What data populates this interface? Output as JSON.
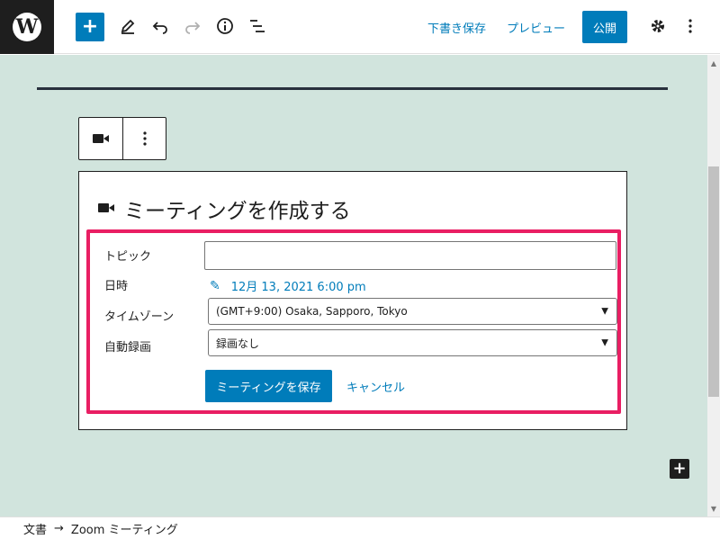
{
  "toolbar": {
    "logo_letter": "W",
    "add_label": "+",
    "edit_icon": "pencil-icon",
    "undo_icon": "undo-icon",
    "redo_icon": "redo-icon",
    "info_icon": "info-icon",
    "outline_icon": "list-view-icon",
    "save_draft_label": "下書き保存",
    "preview_label": "プレビュー",
    "publish_label": "公開",
    "settings_icon": "gear-icon",
    "more_icon": "more-vertical-icon",
    "colors": {
      "accent": "#007cba",
      "dark": "#1e1e1e"
    }
  },
  "canvas": {
    "background": "#d1e4dd"
  },
  "block_toolbar": {
    "block_icon": "video-camera-icon",
    "more_icon": "more-vertical-icon"
  },
  "meeting_block": {
    "title": "ミーティングを作成する",
    "title_icon": "video-camera-icon",
    "highlight_color": "#e91e63",
    "topic": {
      "label": "トピック",
      "value": ""
    },
    "datetime": {
      "label": "日時",
      "value": "12月 13, 2021 6:00 pm"
    },
    "timezone": {
      "label": "タイムゾーン",
      "value": "(GMT+9:00) Osaka, Sapporo, Tokyo"
    },
    "recording": {
      "label": "自動録画",
      "value": "録画なし"
    },
    "save_label": "ミーティングを保存",
    "cancel_label": "キャンセル"
  },
  "inserter": {
    "label": "+"
  },
  "footer": {
    "crumb_root": "文書",
    "separator": "→",
    "crumb_current": "Zoom ミーティング"
  }
}
